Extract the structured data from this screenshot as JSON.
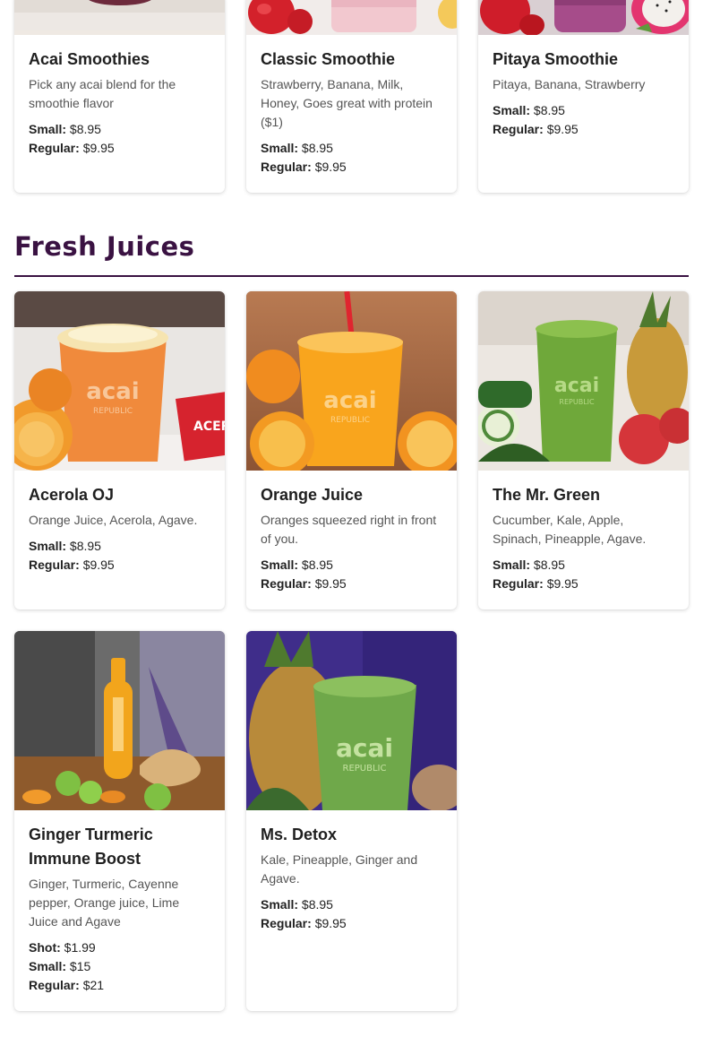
{
  "smoothies": [
    {
      "title": "Acai Smoothies",
      "desc": "Pick any acai blend for the smoothie flavor",
      "prices": [
        {
          "label": "Small:",
          "value": "$8.95"
        },
        {
          "label": "Regular:",
          "value": "$9.95"
        }
      ],
      "image": "acai-smoothie-photo"
    },
    {
      "title": "Classic Smoothie",
      "desc": "Strawberry, Banana, Milk, Honey, Goes great with protein ($1)",
      "prices": [
        {
          "label": "Small:",
          "value": "$8.95"
        },
        {
          "label": "Regular:",
          "value": "$9.95"
        }
      ],
      "image": "classic-smoothie-photo"
    },
    {
      "title": "Pitaya Smoothie",
      "desc": "Pitaya, Banana, Strawberry",
      "prices": [
        {
          "label": "Small:",
          "value": "$8.95"
        },
        {
          "label": "Regular:",
          "value": "$9.95"
        }
      ],
      "image": "pitaya-smoothie-photo"
    }
  ],
  "section": {
    "title": "Fresh Juices",
    "accent": "#3a1242"
  },
  "juices": [
    {
      "title": "Acerola OJ",
      "desc": "Orange Juice, Acerola, Agave.",
      "prices": [
        {
          "label": "Small:",
          "value": "$8.95"
        },
        {
          "label": "Regular:",
          "value": "$9.95"
        }
      ],
      "image": "acerola-oj-photo"
    },
    {
      "title": "Orange Juice",
      "desc": "Oranges squeezed right in front of you.",
      "prices": [
        {
          "label": "Small:",
          "value": "$8.95"
        },
        {
          "label": "Regular:",
          "value": "$9.95"
        }
      ],
      "image": "orange-juice-photo"
    },
    {
      "title": "The Mr. Green",
      "desc": "Cucumber, Kale, Apple, Spinach, Pineapple, Agave.",
      "prices": [
        {
          "label": "Small:",
          "value": "$8.95"
        },
        {
          "label": "Regular:",
          "value": "$9.95"
        }
      ],
      "image": "mr-green-photo"
    },
    {
      "title": "Ginger Turmeric Immune Boost",
      "desc": "Ginger, Turmeric, Cayenne pepper, Orange juice, Lime Juice and Agave",
      "prices": [
        {
          "label": "Shot:",
          "value": "$1.99"
        },
        {
          "label": "Small:",
          "value": "$15"
        },
        {
          "label": "Regular:",
          "value": "$21"
        }
      ],
      "image": "ginger-turmeric-photo"
    },
    {
      "title": "Ms. Detox",
      "desc": "Kale, Pineapple, Ginger and Agave.",
      "prices": [
        {
          "label": "Small:",
          "value": "$8.95"
        },
        {
          "label": "Regular:",
          "value": "$9.95"
        }
      ],
      "image": "ms-detox-photo"
    }
  ],
  "cup_brand": {
    "line1": "acai",
    "line2": "REPUBLIC",
    "sachet": "ACEROL"
  }
}
